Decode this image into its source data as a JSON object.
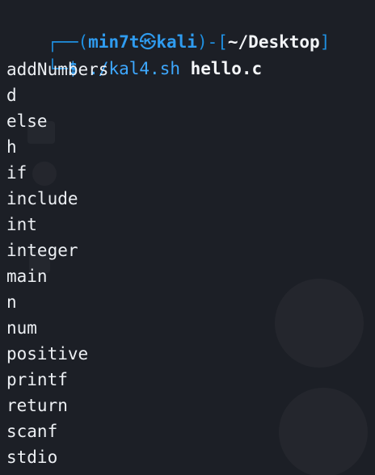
{
  "prompt": {
    "frame_top": "┌──(",
    "user": "min7t",
    "at_symbol": "㉿",
    "host": "kali",
    "frame_mid": ")-[",
    "cwd": "~/Desktop",
    "frame_end": "]",
    "frame_bottom": "└─",
    "dollar": "$",
    "command": "./kal4.sh",
    "argument": "hello.c"
  },
  "output_lines": [
    "addNumbers",
    "d",
    "else",
    "h",
    "if",
    "include",
    "int",
    "integer",
    "main",
    "n",
    "num",
    "positive",
    "printf",
    "return",
    "scanf",
    "stdio"
  ],
  "colors": {
    "background": "#1c1f26",
    "prompt_blue": "#2f9cf0",
    "text": "#eceff3"
  }
}
